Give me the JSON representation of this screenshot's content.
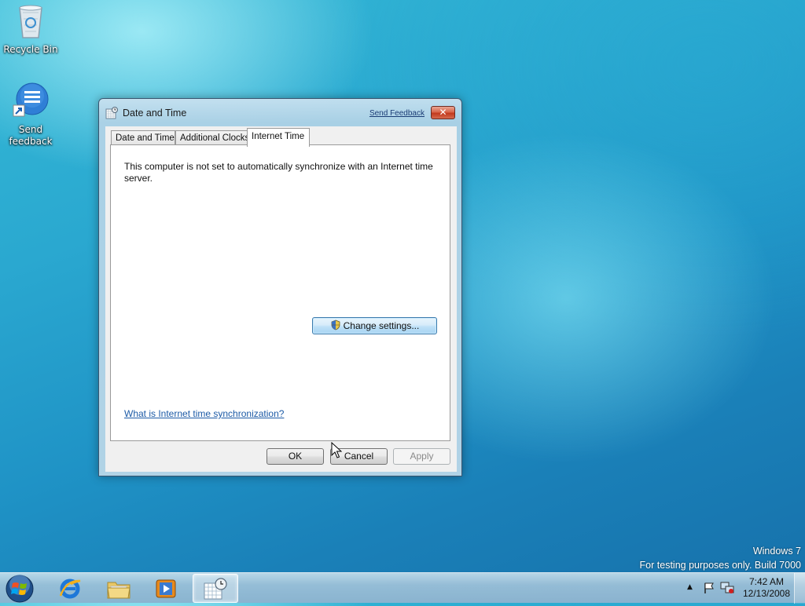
{
  "desktop": {
    "icons": [
      {
        "label": "Recycle Bin",
        "icon": "recycle-bin-icon"
      },
      {
        "label": "Send feedback",
        "icon": "send-feedback-icon"
      }
    ]
  },
  "dialog": {
    "title": "Date and Time",
    "send_feedback": "Send Feedback",
    "close": "✕",
    "tabs": [
      {
        "label": "Date and Time",
        "active": false
      },
      {
        "label": "Additional Clocks",
        "active": false
      },
      {
        "label": "Internet Time",
        "active": true
      }
    ],
    "message": "This computer is not set to automatically synchronize with an Internet time server.",
    "change_settings": "Change settings...",
    "help_link": "What is Internet time synchronization?",
    "buttons": {
      "ok": "OK",
      "cancel": "Cancel",
      "apply": "Apply"
    }
  },
  "watermark": {
    "line1": "Windows 7",
    "line2": "For testing purposes only. Build 7000"
  },
  "taskbar": {
    "items": [
      "start-orb",
      "internet-explorer-icon",
      "windows-explorer-icon",
      "media-player-icon",
      "date-time-icon"
    ],
    "clock_time": "7:42 AM",
    "clock_date": "12/13/2008"
  },
  "colors": {
    "link": "#1c5aa6",
    "close_button": "#c23a1e",
    "accent_button": "#3d7bad"
  }
}
